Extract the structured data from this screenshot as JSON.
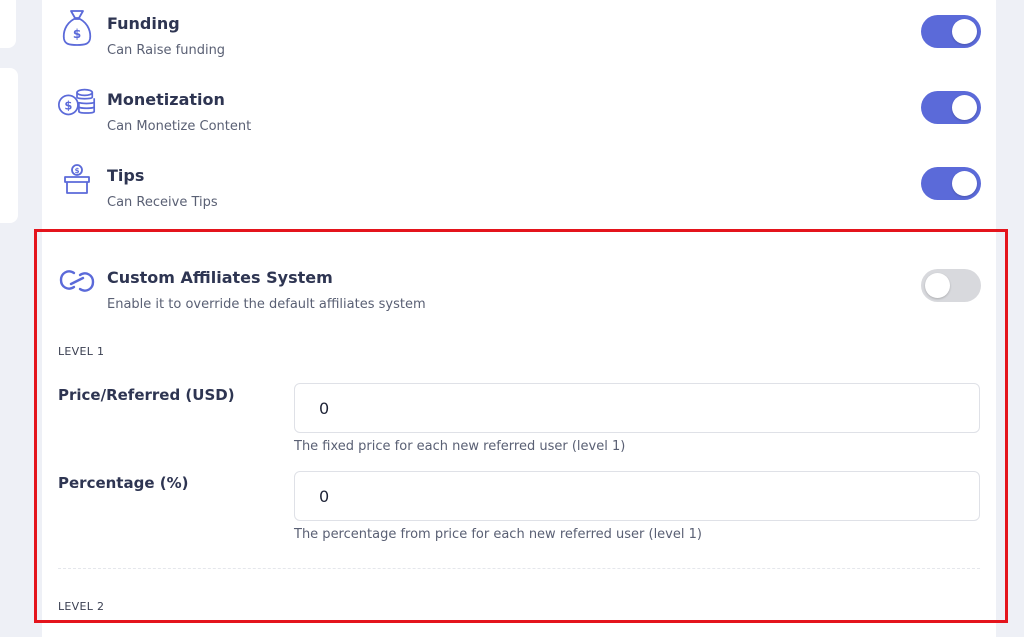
{
  "permissions": [
    {
      "icon": "money-bag-icon",
      "title": "Funding",
      "description": "Can Raise funding",
      "enabled": true
    },
    {
      "icon": "coins-icon",
      "title": "Monetization",
      "description": "Can Monetize Content",
      "enabled": true
    },
    {
      "icon": "tip-jar-icon",
      "title": "Tips",
      "description": "Can Receive Tips",
      "enabled": true
    }
  ],
  "affiliates": {
    "icon": "link-icon",
    "title": "Custom Affiliates System",
    "description": "Enable it to override the default affiliates system",
    "enabled": false,
    "level1": {
      "label": "LEVEL 1",
      "price_label": "Price/Referred (USD)",
      "price_value": "0",
      "price_help": "The fixed price for each new referred user (level 1)",
      "percentage_label": "Percentage (%)",
      "percentage_value": "0",
      "percentage_help": "The percentage from price for each new referred user (level 1)"
    },
    "level2": {
      "label": "LEVEL 2"
    }
  },
  "colors": {
    "accent": "#5b6ad9",
    "highlight_border": "#e4141c",
    "toggle_off": "#d8d9dd"
  }
}
